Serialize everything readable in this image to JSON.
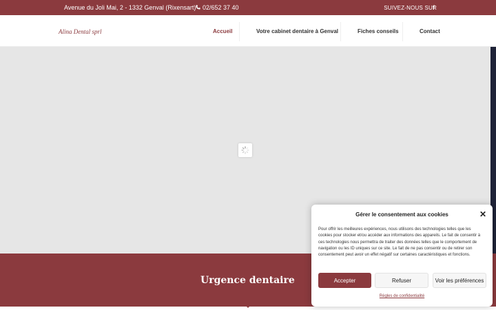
{
  "topbar": {
    "address": "Avenue du Joli Mai, 2 - 1332 Genval (Rixensart)",
    "phone": "02/652 37 40",
    "follow": "SUIVEZ-NOUS SUR",
    "social_icon": "facebook-icon"
  },
  "header": {
    "logo": "Alina Dental sprl",
    "nav": [
      {
        "label": "Accueil",
        "active": true
      },
      {
        "label": "Votre cabinet dentaire à Genval"
      },
      {
        "label": "Fiches conseils"
      },
      {
        "label": "Contact"
      }
    ]
  },
  "slider": {
    "spinner_icon": "loading-spinner-icon"
  },
  "urgence": {
    "title": "Urgence dentaire"
  },
  "cookie": {
    "title": "Gérer le consentement aux cookies",
    "text": "Pour offrir les meilleures expériences, nous utilisons des technologies telles que les cookies pour stocker et/ou accéder aux informations des appareils. Le fait de consentir à ces technologies nous permettra de traiter des données telles que le comportement de navigation ou les ID uniques sur ce site. Le fait de ne pas consentir ou de retirer son consentement peut avoir un effet négatif sur certaines caractéristiques et fonctions.",
    "accept": "Accepter",
    "refuse": "Refuser",
    "prefs": "Voir les préférences",
    "link": "Règles de confidentialité"
  },
  "colors": {
    "brand": "#8b3a3e",
    "dark": "#1f2338"
  }
}
